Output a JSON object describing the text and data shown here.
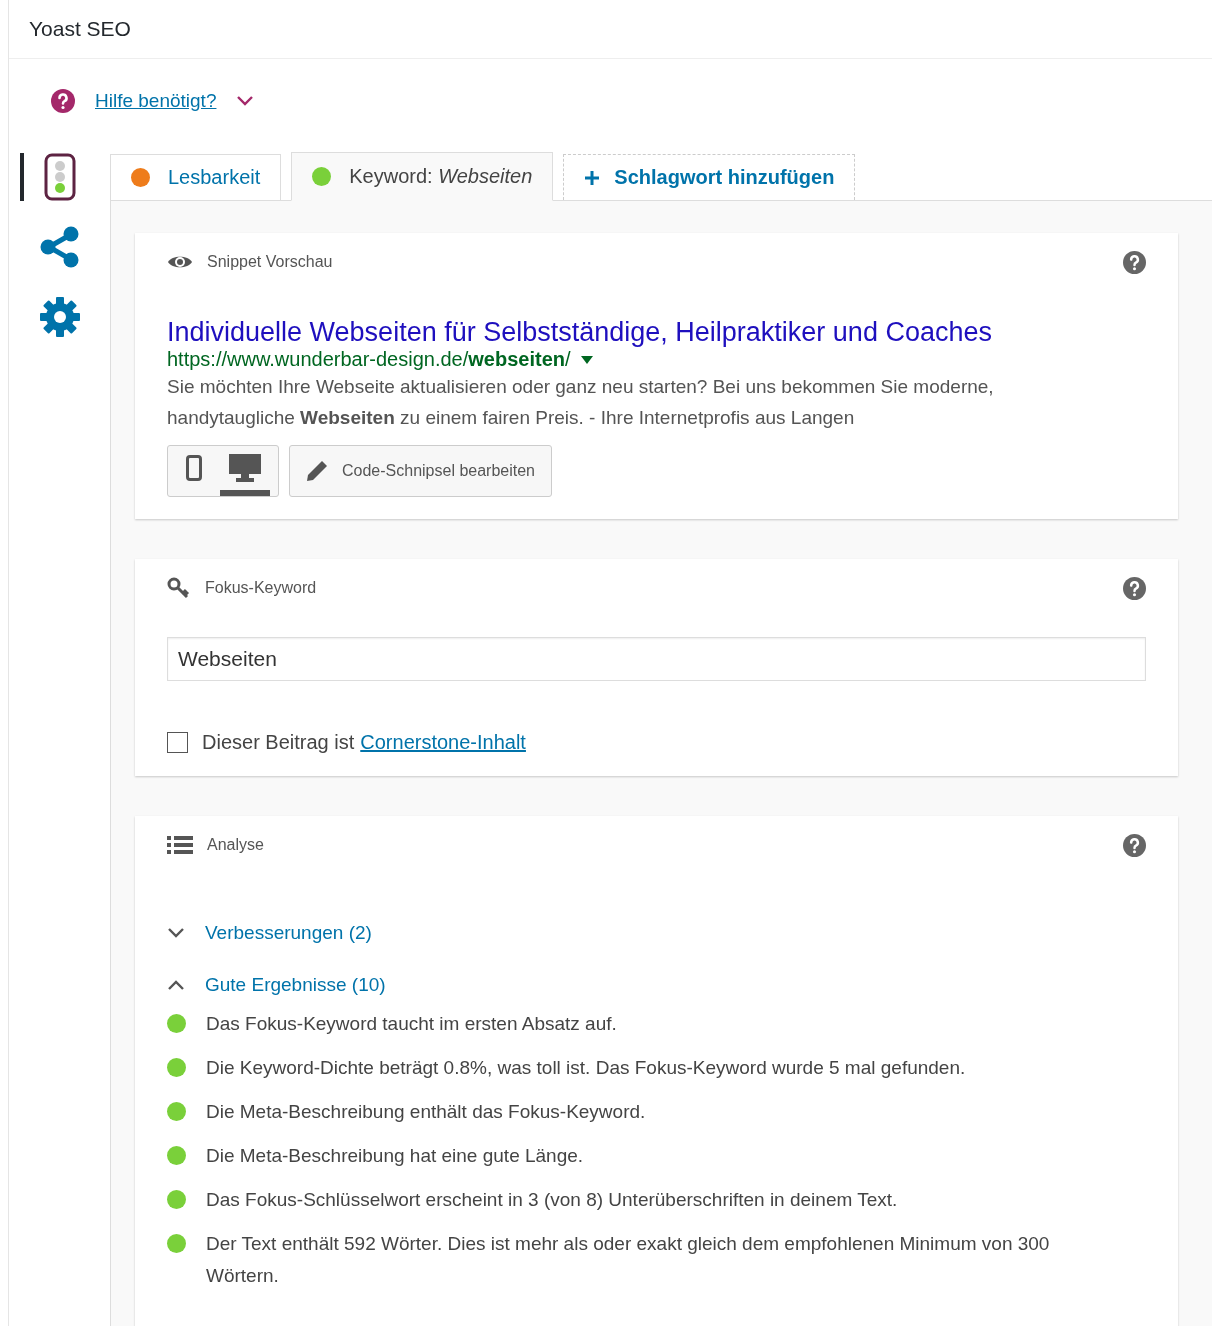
{
  "panel": {
    "title": "Yoast SEO"
  },
  "help": {
    "label": "Hilfe benötigt?",
    "expanded": false
  },
  "sidebar": [
    {
      "kind": "traffic",
      "selected": true
    },
    {
      "kind": "share",
      "selected": false
    },
    {
      "kind": "gear",
      "selected": false
    }
  ],
  "tabs": [
    {
      "label": "Lesbarkeit",
      "color": "#ee7c1b",
      "selected": false
    },
    {
      "label": "Keyword: *Webseiten*",
      "color": "#7ad03a",
      "selected": true
    }
  ],
  "add_tab": {
    "label": "Schlagwort hinzufügen"
  },
  "snippet": {
    "heading": "Snippet Vorschau",
    "title": "Individuelle Webseiten für Selbstständige, Heilpraktiker und Coaches",
    "url": "https://www.wunderbar-design.de/**webseiten**/",
    "description": "Sie möchten Ihre Webseite aktualisieren oder ganz neu starten? Bei uns bekommen Sie moderne, handytaugliche **Webseiten** zu einem fairen Preis. - Ihre Internetprofis aus Langen",
    "devices": [
      {
        "kind": "mobile",
        "selected": false
      },
      {
        "kind": "desktop",
        "selected": true
      }
    ],
    "edit_button": "Code-Schnipsel bearbeiten"
  },
  "keyword": {
    "heading": "Fokus-Keyword",
    "value": "Webseiten",
    "cornerstone": {
      "checked": false,
      "label": "Dieser Beitrag ist",
      "link": "Cornerstone-Inhalt"
    }
  },
  "analysis": {
    "heading": "Analyse",
    "groups": [
      {
        "label": "Verbesserungen (2)",
        "expanded": false
      },
      {
        "label": "Gute Ergebnisse (10)",
        "expanded": true,
        "items": [
          {
            "text": "Das Fokus-Keyword taucht im ersten Absatz auf.",
            "color": "#7ad03a"
          },
          {
            "text": "Die Keyword-Dichte beträgt 0.8%, was toll ist. Das Fokus-Keyword wurde 5 mal gefunden.",
            "color": "#7ad03a"
          },
          {
            "text": "Die Meta-Beschreibung enthält das Fokus-Keyword.",
            "color": "#7ad03a"
          },
          {
            "text": "Die Meta-Beschreibung hat eine gute Länge.",
            "color": "#7ad03a"
          },
          {
            "text": "Das Fokus-Schlüsselwort erscheint in 3 (von 8) Unterüberschriften in deinem Text.",
            "color": "#7ad03a"
          },
          {
            "text": "Der Text enthält 592 Wörter. Dies ist mehr als oder exakt gleich dem empfohlenen Minimum von 300 Wörtern.",
            "color": "#7ad03a"
          }
        ]
      }
    ]
  }
}
